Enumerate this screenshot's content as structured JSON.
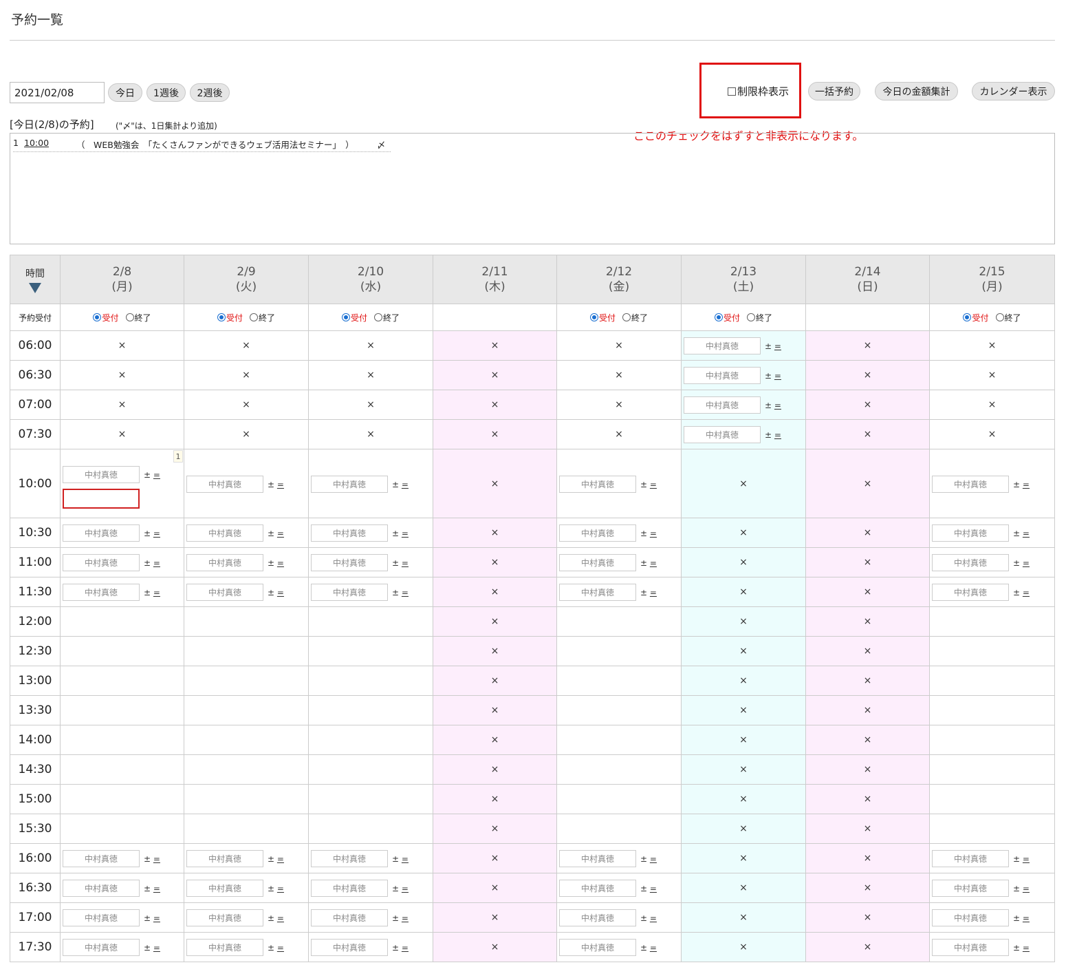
{
  "page_title": "予約一覧",
  "date_value": "2021/02/08",
  "buttons": {
    "today": "今日",
    "week1": "1週後",
    "week2": "2週後",
    "bulk": "一括予約",
    "sum": "今日の金額集計",
    "calendar": "カレンダー表示"
  },
  "limit_label": "制限枠表示",
  "note": "ここのチェックをはずすと非表示になります。",
  "today_label": "[今日(2/8)の予約]",
  "today_note": "(\"〆\"は、1日集計より追加)",
  "today_items": [
    {
      "num": "1",
      "time": "10:00",
      "desc": "（　WEB勉強会　「たくさんファンができるウェブ活用法セミナー」　）",
      "mark": "〆"
    }
  ],
  "grid": {
    "time_header": "時間",
    "accept_label": "予約受付",
    "radio_accept": "受付",
    "radio_end": "終了",
    "slot_name": "中村真徳",
    "pm": "±",
    "eq": "=",
    "x": "×",
    "badge": "1",
    "days": [
      {
        "date": "2/8",
        "dow": "(月)"
      },
      {
        "date": "2/9",
        "dow": "(火)"
      },
      {
        "date": "2/10",
        "dow": "(水)"
      },
      {
        "date": "2/11",
        "dow": "(木)"
      },
      {
        "date": "2/12",
        "dow": "(金)"
      },
      {
        "date": "2/13",
        "dow": "(土)"
      },
      {
        "date": "2/14",
        "dow": "(日)"
      },
      {
        "date": "2/15",
        "dow": "(月)"
      }
    ],
    "times": [
      "06:00",
      "06:30",
      "07:00",
      "07:30",
      "10:00",
      "10:30",
      "11:00",
      "11:30",
      "12:00",
      "12:30",
      "13:00",
      "13:30",
      "14:00",
      "14:30",
      "15:00",
      "15:30",
      "16:00",
      "16:30",
      "17:00",
      "17:30"
    ]
  }
}
